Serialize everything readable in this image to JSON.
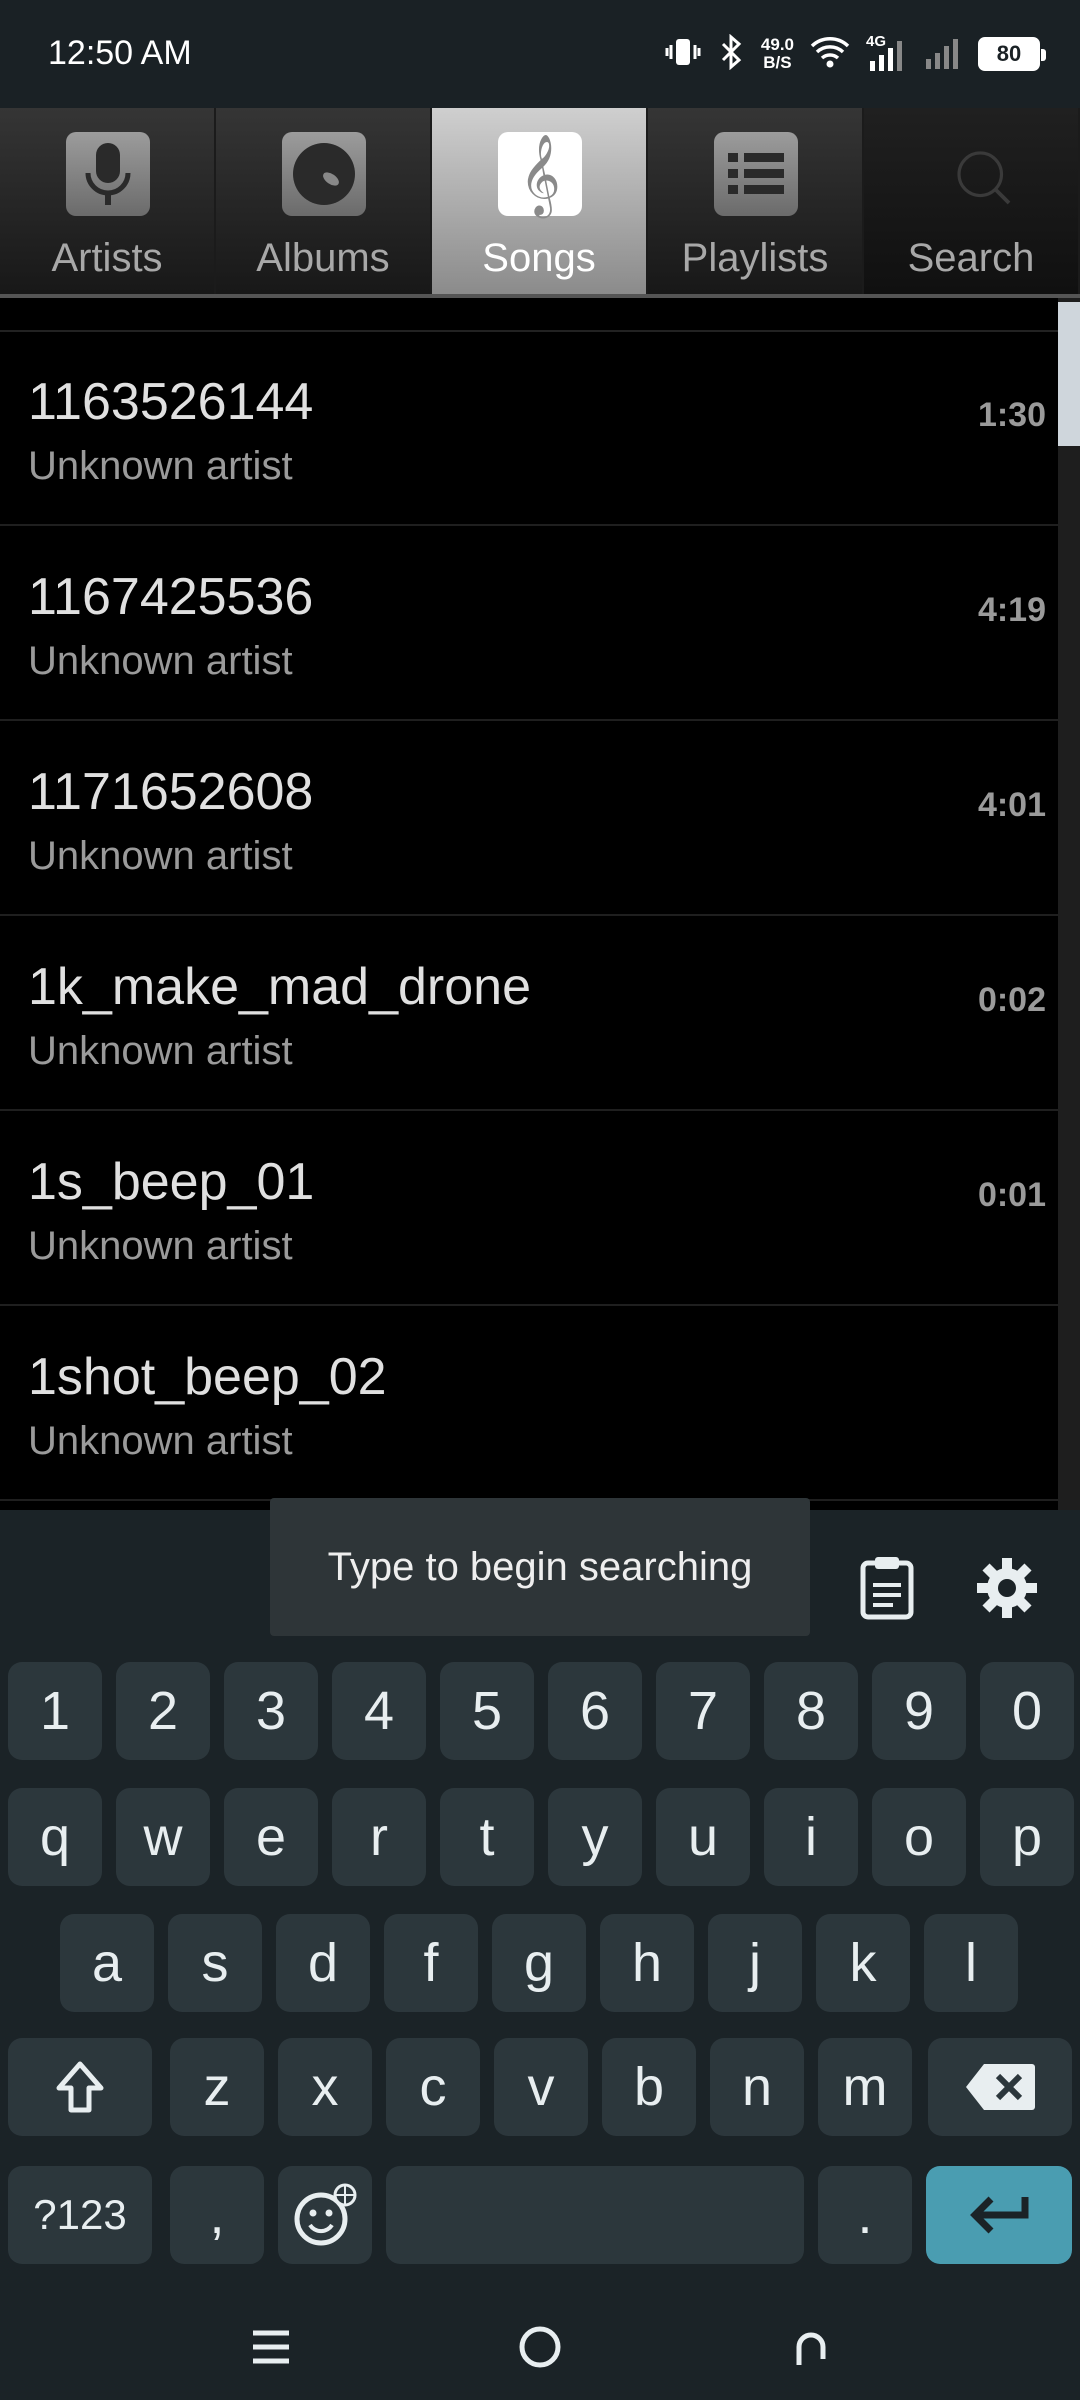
{
  "status": {
    "time": "12:50 AM",
    "net_speed_value": "49.0",
    "net_speed_unit": "B/S",
    "network_type": "4G",
    "battery": "80"
  },
  "tabs": [
    {
      "label": "Artists",
      "icon": "microphone-icon",
      "active": false
    },
    {
      "label": "Albums",
      "icon": "disc-icon",
      "active": false
    },
    {
      "label": "Songs",
      "icon": "treble-clef-icon",
      "active": true
    },
    {
      "label": "Playlists",
      "icon": "list-icon",
      "active": false
    },
    {
      "label": "Search",
      "icon": "search-icon",
      "active": false
    }
  ],
  "songs": [
    {
      "title": "1163526144",
      "artist": "Unknown artist",
      "duration": "1:30"
    },
    {
      "title": "1167425536",
      "artist": "Unknown artist",
      "duration": "4:19"
    },
    {
      "title": "1171652608",
      "artist": "Unknown artist",
      "duration": "4:01"
    },
    {
      "title": "1k_make_mad_drone",
      "artist": "Unknown artist",
      "duration": "0:02"
    },
    {
      "title": "1s_beep_01",
      "artist": "Unknown artist",
      "duration": "0:01"
    },
    {
      "title": "1shot_beep_02",
      "artist": "Unknown artist",
      "duration": ""
    }
  ],
  "keyboard": {
    "row_numbers": [
      "1",
      "2",
      "3",
      "4",
      "5",
      "6",
      "7",
      "8",
      "9",
      "0"
    ],
    "row_q": [
      "q",
      "w",
      "e",
      "r",
      "t",
      "y",
      "u",
      "i",
      "o",
      "p"
    ],
    "row_a": [
      "a",
      "s",
      "d",
      "f",
      "g",
      "h",
      "j",
      "k",
      "l"
    ],
    "row_z": [
      "z",
      "x",
      "c",
      "v",
      "b",
      "n",
      "m"
    ],
    "symbols_key": "?123",
    "comma_key": ",",
    "period_key": ".",
    "toolbar_icons": [
      "clipboard-icon",
      "gear-icon"
    ]
  },
  "toast": "Type to begin searching",
  "colors": {
    "enter_key": "#4a9db1",
    "keyboard_bg": "#1b2327",
    "key_bg": "#2c373c"
  }
}
